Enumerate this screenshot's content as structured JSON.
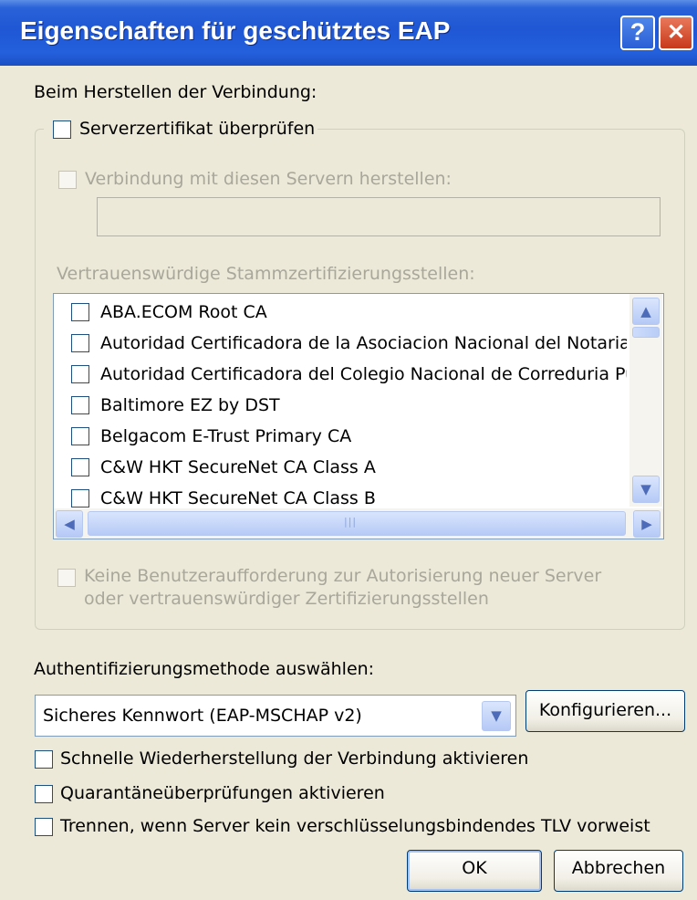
{
  "window": {
    "title": "Eigenschaften für geschütztes EAP",
    "help_label": "?",
    "close_label": "✕"
  },
  "connection": {
    "heading": "Beim Herstellen der Verbindung:",
    "verify_cert_label": "Serverzertifikat überprüfen",
    "connect_servers_label": "Verbindung mit diesen Servern herstellen:",
    "server_input_value": "",
    "trusted_ca_heading": "Vertrauenswürdige Stammzertifizierungsstellen:",
    "trusted_cas": [
      "ABA.ECOM Root CA",
      "Autoridad Certificadora de la Asociacion Nacional del Notariado",
      "Autoridad Certificadora del Colegio Nacional de Correduria Publica",
      "Baltimore EZ by DST",
      "Belgacom E-Trust Primary CA",
      "C&W HKT SecureNet CA Class A",
      "C&W HKT SecureNet CA Class B"
    ],
    "no_prompt_line1": "Keine Benutzeraufforderung zur Autorisierung neuer Server",
    "no_prompt_line2": "oder vertrauenswürdiger Zertifizierungsstellen"
  },
  "auth": {
    "heading": "Authentifizierungsmethode auswählen:",
    "method_value": "Sicheres Kennwort (EAP-MSCHAP v2)",
    "configure_label": "Konfigurieren..."
  },
  "options": {
    "fast_reconnect_label": "Schnelle Wiederherstellung der Verbindung aktivieren",
    "quarantine_label": "Quarantäneüberprüfungen aktivieren",
    "disconnect_tlv_label": "Trennen, wenn Server kein verschlüsselungsbindendes TLV vorweist"
  },
  "buttons": {
    "ok_label": "OK",
    "cancel_label": "Abbrechen"
  },
  "icons": {
    "scroll_up": "▲",
    "scroll_down": "▼",
    "scroll_left": "◀",
    "scroll_right": "▶",
    "dropdown": "▼",
    "grip": "|||"
  },
  "colors": {
    "titlebar": "#2460dc",
    "close_button": "#c8391b",
    "dialog_background": "#ece9d8"
  }
}
